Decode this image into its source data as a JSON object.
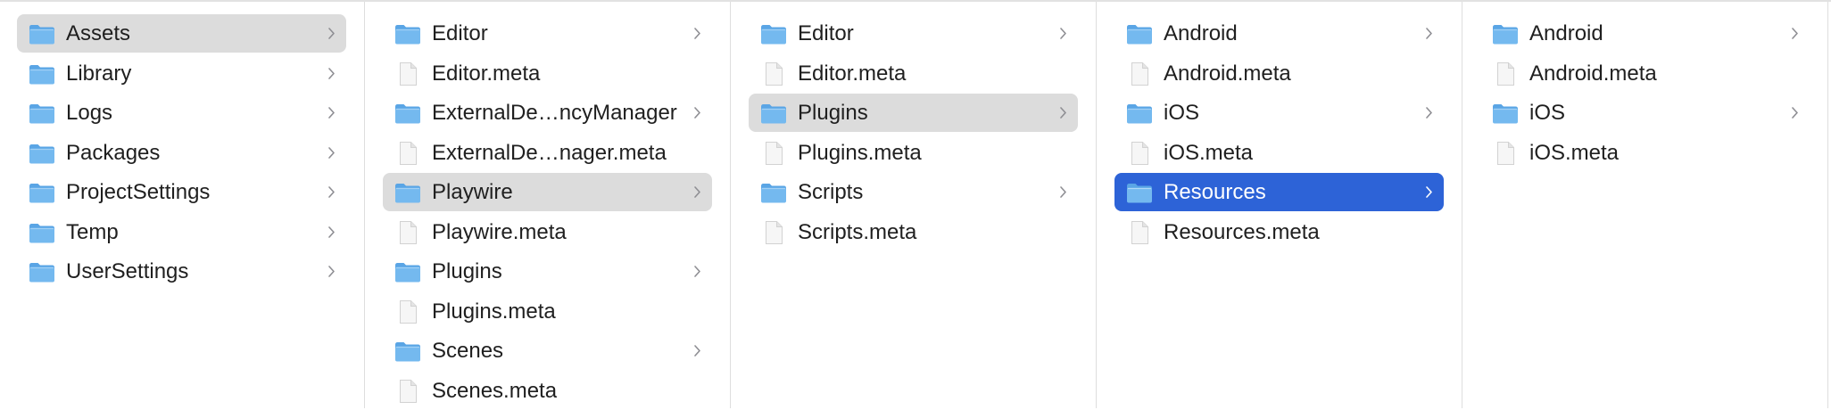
{
  "columns": [
    {
      "items": [
        {
          "name": "Assets",
          "kind": "folder",
          "expandable": true,
          "selected": "gray"
        },
        {
          "name": "Library",
          "kind": "folder",
          "expandable": true,
          "selected": ""
        },
        {
          "name": "Logs",
          "kind": "folder",
          "expandable": true,
          "selected": ""
        },
        {
          "name": "Packages",
          "kind": "folder",
          "expandable": true,
          "selected": ""
        },
        {
          "name": "ProjectSettings",
          "kind": "folder",
          "expandable": true,
          "selected": ""
        },
        {
          "name": "Temp",
          "kind": "folder",
          "expandable": true,
          "selected": ""
        },
        {
          "name": "UserSettings",
          "kind": "folder",
          "expandable": true,
          "selected": ""
        }
      ]
    },
    {
      "items": [
        {
          "name": "Editor",
          "kind": "folder",
          "expandable": true,
          "selected": ""
        },
        {
          "name": "Editor.meta",
          "kind": "file",
          "expandable": false,
          "selected": ""
        },
        {
          "name": "ExternalDe…ncyManager",
          "kind": "folder",
          "expandable": true,
          "selected": ""
        },
        {
          "name": "ExternalDe…nager.meta",
          "kind": "file",
          "expandable": false,
          "selected": ""
        },
        {
          "name": "Playwire",
          "kind": "folder",
          "expandable": true,
          "selected": "gray"
        },
        {
          "name": "Playwire.meta",
          "kind": "file",
          "expandable": false,
          "selected": ""
        },
        {
          "name": "Plugins",
          "kind": "folder",
          "expandable": true,
          "selected": ""
        },
        {
          "name": "Plugins.meta",
          "kind": "file",
          "expandable": false,
          "selected": ""
        },
        {
          "name": "Scenes",
          "kind": "folder",
          "expandable": true,
          "selected": ""
        },
        {
          "name": "Scenes.meta",
          "kind": "file",
          "expandable": false,
          "selected": ""
        }
      ]
    },
    {
      "items": [
        {
          "name": "Editor",
          "kind": "folder",
          "expandable": true,
          "selected": ""
        },
        {
          "name": "Editor.meta",
          "kind": "file",
          "expandable": false,
          "selected": ""
        },
        {
          "name": "Plugins",
          "kind": "folder",
          "expandable": true,
          "selected": "gray"
        },
        {
          "name": "Plugins.meta",
          "kind": "file",
          "expandable": false,
          "selected": ""
        },
        {
          "name": "Scripts",
          "kind": "folder",
          "expandable": true,
          "selected": ""
        },
        {
          "name": "Scripts.meta",
          "kind": "file",
          "expandable": false,
          "selected": ""
        }
      ]
    },
    {
      "items": [
        {
          "name": "Android",
          "kind": "folder",
          "expandable": true,
          "selected": ""
        },
        {
          "name": "Android.meta",
          "kind": "file",
          "expandable": false,
          "selected": ""
        },
        {
          "name": "iOS",
          "kind": "folder",
          "expandable": true,
          "selected": ""
        },
        {
          "name": "iOS.meta",
          "kind": "file",
          "expandable": false,
          "selected": ""
        },
        {
          "name": "Resources",
          "kind": "folder",
          "expandable": true,
          "selected": "blue"
        },
        {
          "name": "Resources.meta",
          "kind": "file",
          "expandable": false,
          "selected": ""
        }
      ]
    },
    {
      "items": [
        {
          "name": "Android",
          "kind": "folder",
          "expandable": true,
          "selected": ""
        },
        {
          "name": "Android.meta",
          "kind": "file",
          "expandable": false,
          "selected": ""
        },
        {
          "name": "iOS",
          "kind": "folder",
          "expandable": true,
          "selected": ""
        },
        {
          "name": "iOS.meta",
          "kind": "file",
          "expandable": false,
          "selected": ""
        }
      ]
    }
  ],
  "icons": {
    "folder": "folder-icon",
    "file": "document-icon",
    "chevron": "chevron-right-icon"
  },
  "colors": {
    "folder_front": "#74b9ef",
    "folder_back": "#5aa5e5",
    "selection_inactive": "#dcdcdc",
    "selection_active": "#2d63d7",
    "text": "#1f1f1f",
    "chevron": "#8e8e93"
  }
}
